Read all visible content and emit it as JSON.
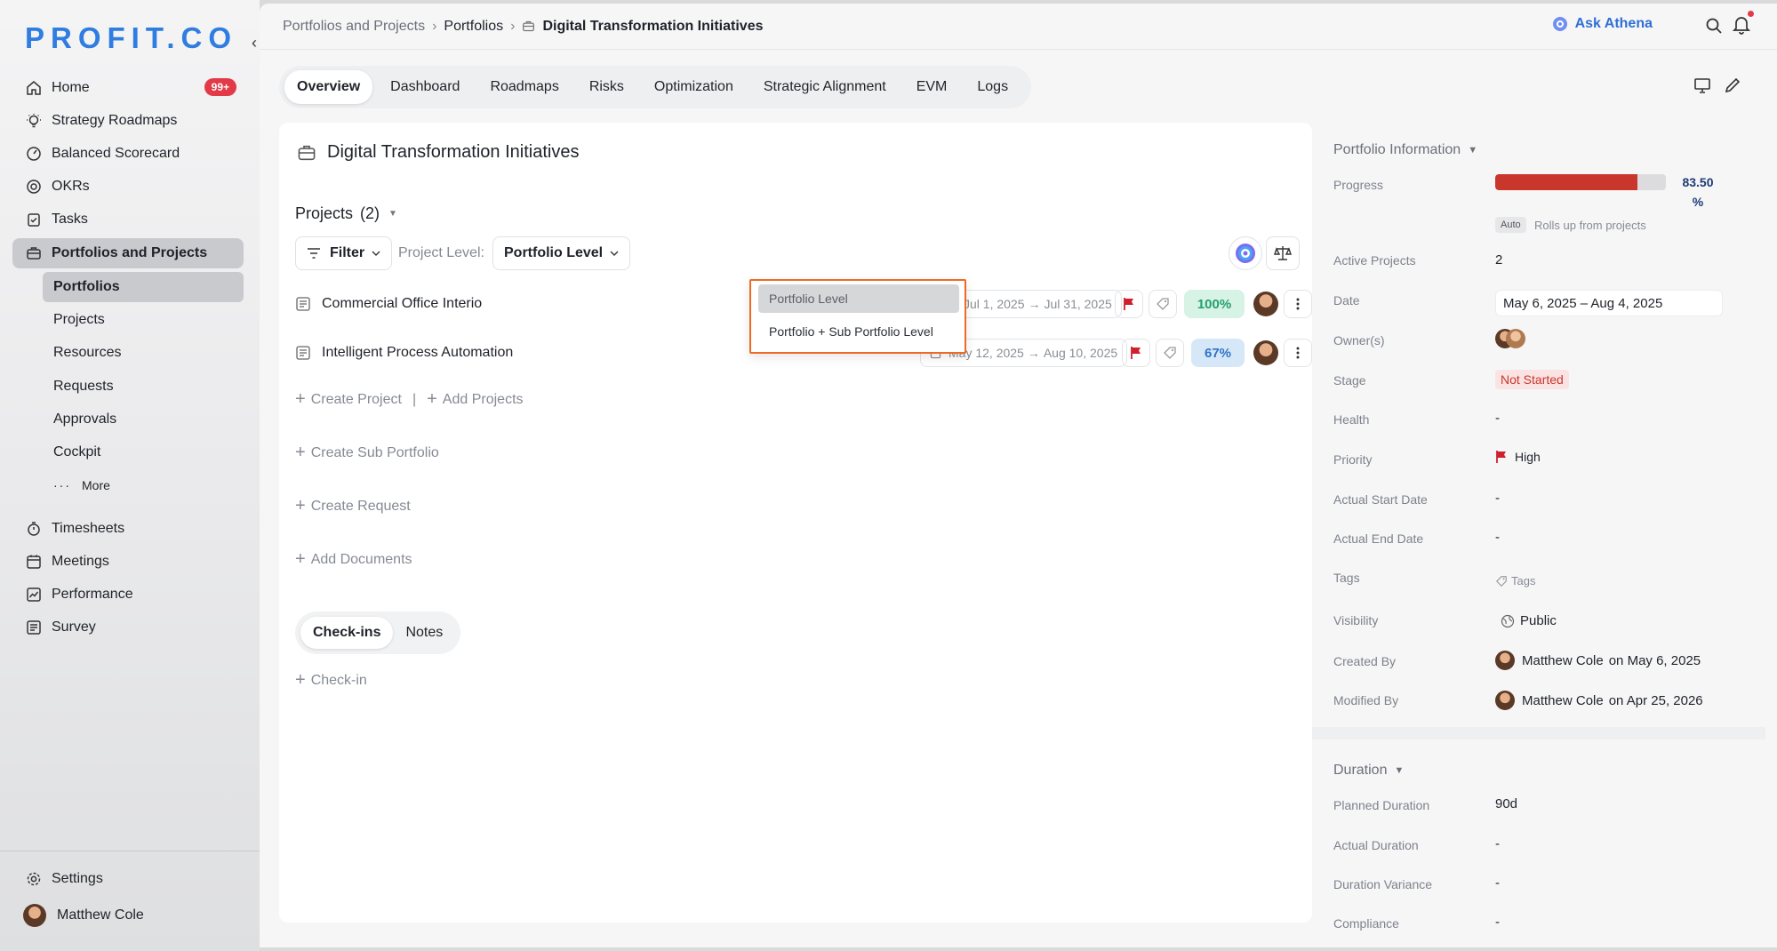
{
  "sidebar": {
    "logo": "PROFIT.CO",
    "collapse": "‹",
    "home_badge": "99+",
    "items": [
      {
        "label": "Home"
      },
      {
        "label": "Strategy Roadmaps"
      },
      {
        "label": "Balanced Scorecard"
      },
      {
        "label": "OKRs"
      },
      {
        "label": "Tasks"
      },
      {
        "label": "Portfolios and Projects"
      }
    ],
    "sub_items": [
      {
        "label": "Portfolios"
      },
      {
        "label": "Projects"
      },
      {
        "label": "Resources"
      },
      {
        "label": "Requests"
      },
      {
        "label": "Approvals"
      },
      {
        "label": "Cockpit"
      },
      {
        "label": "More"
      }
    ],
    "items_after": [
      {
        "label": "Timesheets"
      },
      {
        "label": "Meetings"
      },
      {
        "label": "Performance"
      },
      {
        "label": "Survey"
      }
    ],
    "settings": "Settings",
    "user": "Matthew Cole"
  },
  "topbar": {
    "crumbs": [
      "Portfolios and Projects",
      "Portfolios",
      "Digital Transformation Initiatives"
    ],
    "sep": "›",
    "ask": "Ask Athena"
  },
  "tabs": [
    "Overview",
    "Dashboard",
    "Roadmaps",
    "Risks",
    "Optimization",
    "Strategic Alignment",
    "EVM",
    "Logs"
  ],
  "main": {
    "title": "Digital Transformation Initiatives",
    "projects_label": "Projects",
    "projects_count": "(2)",
    "filter": "Filter",
    "level_label": "Project Level:",
    "level_value": "Portfolio Level",
    "projects": [
      {
        "name": "Commercial Office Interio",
        "start": "Jul 1, 2025",
        "end": "Jul 31, 2025",
        "progress": "100%"
      },
      {
        "name": "Intelligent Process Automation",
        "start": "May 12, 2025",
        "end": "Aug 10, 2025",
        "progress": "67%"
      }
    ],
    "arrow": "→",
    "actions": {
      "create_project": "Create Project",
      "sep": "|",
      "add_projects": "Add Projects",
      "create_sub": "Create Sub Portfolio",
      "create_request": "Create Request",
      "add_documents": "Add Documents"
    },
    "sub_tabs": [
      "Check-ins",
      "Notes"
    ],
    "checkin": "Check-in"
  },
  "dropdown": {
    "options": [
      "Portfolio Level",
      "Portfolio + Sub Portfolio Level"
    ],
    "selected": "Portfolio Level"
  },
  "info": {
    "section": "Portfolio Information",
    "progress_label": "Progress",
    "progress_value": 83.5,
    "progress_text": "83.50",
    "progress_unit": "%",
    "auto": "Auto",
    "rolls": "Rolls up from projects",
    "rows": [
      {
        "label": "Active Projects",
        "value": "2"
      },
      {
        "label": "Date",
        "value": "May 6, 2025 – Aug 4, 2025"
      },
      {
        "label": "Owner(s)",
        "value": ""
      },
      {
        "label": "Stage",
        "value": "Not Started"
      },
      {
        "label": "Health",
        "value": "-"
      },
      {
        "label": "Priority",
        "value": "High"
      },
      {
        "label": "Actual Start Date",
        "value": "-"
      },
      {
        "label": "Actual End Date",
        "value": "-"
      },
      {
        "label": "Tags",
        "value": "Tags"
      },
      {
        "label": "Visibility",
        "value": "Public"
      },
      {
        "label": "Created By",
        "value": "Matthew Cole",
        "suffix": "on May 6, 2025"
      },
      {
        "label": "Modified By",
        "value": "Matthew Cole",
        "suffix": "on Apr 25, 2026"
      }
    ],
    "duration_section": "Duration",
    "duration_rows": [
      {
        "label": "Planned Duration",
        "value": "90d"
      },
      {
        "label": "Actual Duration",
        "value": "-"
      },
      {
        "label": "Duration Variance",
        "value": "-"
      },
      {
        "label": "Compliance",
        "value": "-"
      }
    ]
  },
  "colors": {
    "accent": "#2f7de0",
    "progress_fill": "#c9372c",
    "dropdown_border": "#ef6a23",
    "badge": "#e23a46"
  }
}
